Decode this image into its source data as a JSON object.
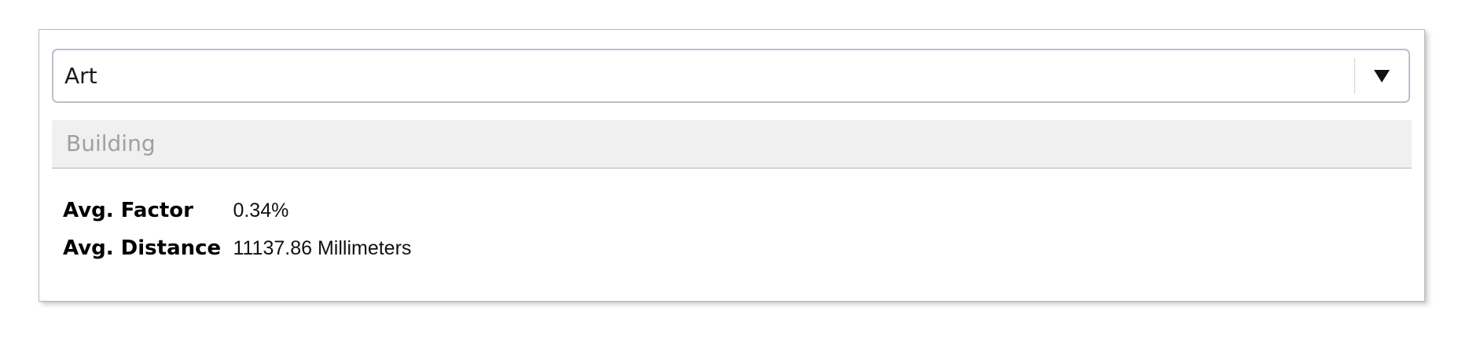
{
  "dropdown": {
    "selected": "Art",
    "arrow_icon": "triangle-down-icon"
  },
  "section": {
    "title": "Building"
  },
  "properties": [
    {
      "label": "Avg. Factor",
      "value": "0.34%"
    },
    {
      "label": "Avg. Distance",
      "value": "11137.86 Millimeters"
    }
  ]
}
